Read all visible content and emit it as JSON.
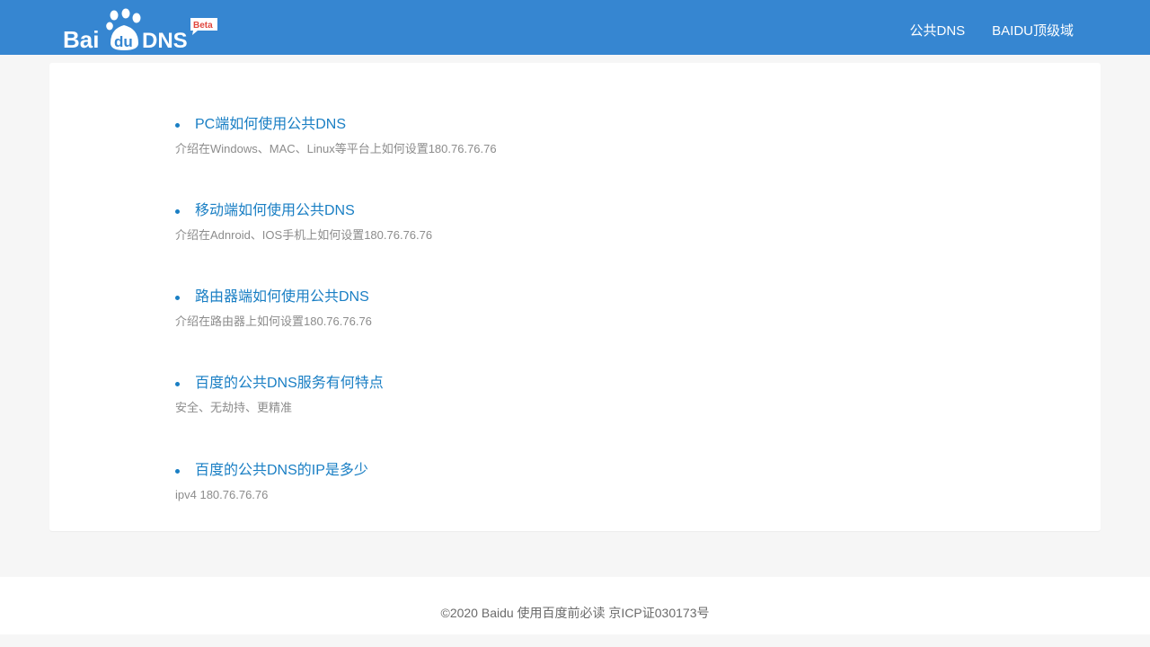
{
  "header": {
    "logo": {
      "brand_text": "Baidu DNS",
      "badge": "Beta"
    },
    "nav": [
      {
        "label": "公共DNS"
      },
      {
        "label": "BAIDU顶级域"
      }
    ]
  },
  "faq": [
    {
      "title": "PC端如何使用公共DNS",
      "desc": "介绍在Windows、MAC、Linux等平台上如何设置180.76.76.76"
    },
    {
      "title": "移动端如何使用公共DNS",
      "desc": "介绍在Adnroid、IOS手机上如何设置180.76.76.76"
    },
    {
      "title": "路由器端如何使用公共DNS",
      "desc": "介绍在路由器上如何设置180.76.76.76"
    },
    {
      "title": "百度的公共DNS服务有何特点",
      "desc": "安全、无劫持、更精准"
    },
    {
      "title": "百度的公共DNS的IP是多少",
      "desc": "ipv4 180.76.76.76"
    }
  ],
  "footer": {
    "text": "©2020 Baidu 使用百度前必读 京ICP证030173号"
  },
  "colors": {
    "header_bg": "#3686d1",
    "link": "#1a7fc4",
    "desc": "#8c8c8c",
    "badge": "#e0473e"
  }
}
